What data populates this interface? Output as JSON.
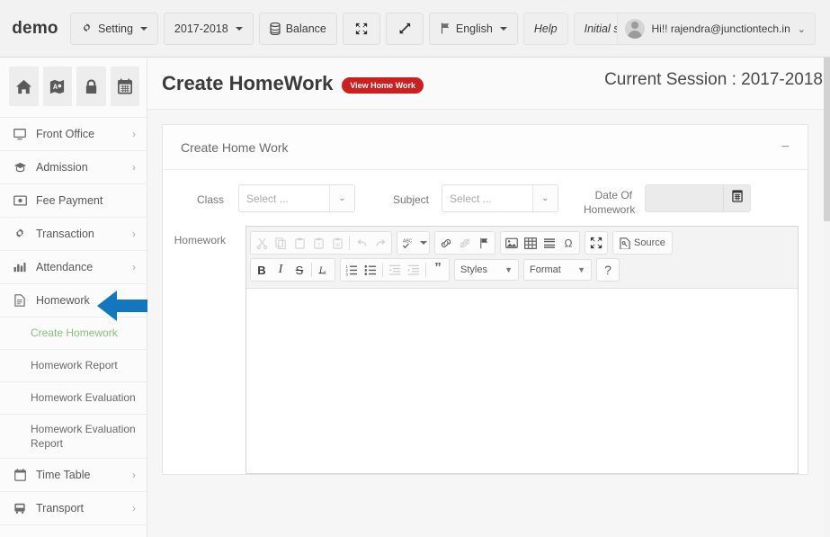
{
  "header": {
    "brand": "demo",
    "buttons": [
      {
        "label": "Setting",
        "icon": "gear-icon",
        "caret": true
      },
      {
        "label": "2017-2018",
        "icon": null,
        "caret": true
      },
      {
        "label": "Balance",
        "icon": "database-icon",
        "caret": false
      },
      {
        "label": "",
        "icon": "collapse-icon",
        "caret": false
      },
      {
        "label": "",
        "icon": "expand-icon",
        "caret": false
      },
      {
        "label": "English",
        "icon": "flag-icon",
        "caret": true
      },
      {
        "label": "Help",
        "icon": null,
        "caret": false
      },
      {
        "label": "Initial setup",
        "icon": null,
        "caret": false
      }
    ],
    "user": {
      "greeting": "Hi!! rajendra@junctiontech.in",
      "caret": "⌄"
    }
  },
  "sidebar": {
    "quick_icons": [
      "home-icon",
      "book-map-icon",
      "lock-icon",
      "calendar-icon"
    ],
    "items": [
      {
        "label": "Front Office",
        "icon": "monitor-icon",
        "chevron": "›"
      },
      {
        "label": "Admission",
        "icon": "graduation-cap-icon",
        "chevron": "›"
      },
      {
        "label": "Fee Payment",
        "icon": "money-icon",
        "chevron": ""
      },
      {
        "label": "Transaction",
        "icon": "gear-icon",
        "chevron": "›"
      },
      {
        "label": "Attendance",
        "icon": "bar-chart-icon",
        "chevron": "›"
      },
      {
        "label": "Homework",
        "icon": "file-icon",
        "chevron": ""
      }
    ],
    "subitems": [
      {
        "label": "Create Homework",
        "active": true
      },
      {
        "label": "Homework Report",
        "active": false
      },
      {
        "label": "Homework Evaluation",
        "active": false
      },
      {
        "label": "Homework Evaluation Report",
        "active": false
      }
    ],
    "items_after": [
      {
        "label": "Time Table",
        "icon": "calendar-icon",
        "chevron": "›"
      },
      {
        "label": "Transport",
        "icon": "bus-icon",
        "chevron": "›"
      }
    ],
    "active_color": "#87c279"
  },
  "page": {
    "title": "Create HomeWork",
    "badge": "View Home Work",
    "badge_color": "#cc1f1f",
    "session": "Current Session : 2017-2018"
  },
  "panel": {
    "title": "Create Home Work",
    "collapse_icon": "−"
  },
  "form": {
    "class": {
      "label": "Class",
      "value": "Select ...",
      "caret": "⌄"
    },
    "subject": {
      "label": "Subject",
      "value": "Select ...",
      "caret": "⌄"
    },
    "date": {
      "label": "Date Of Homework",
      "value": "",
      "button_icon": "calendar-icon"
    },
    "homework": {
      "label": "Homework",
      "content": ""
    }
  },
  "editor": {
    "row1": [
      {
        "name": "cut-icon",
        "glyph": "✂",
        "dim": true
      },
      {
        "name": "copy-icon",
        "glyph": "⎘",
        "dim": true
      },
      {
        "name": "paste-icon",
        "glyph": "ὌB",
        "dim": true
      },
      {
        "name": "paste-text-icon",
        "glyph": "T",
        "dim": true
      },
      {
        "name": "paste-word-icon",
        "glyph": "W",
        "dim": true
      },
      {
        "name": "undo-icon",
        "glyph": "↶",
        "dim": true
      },
      {
        "name": "redo-icon",
        "glyph": "↷",
        "dim": true
      },
      {
        "name": "spellcheck-icon",
        "glyph": "ABC",
        "dim": false
      },
      {
        "name": "link-icon",
        "glyph": "⚭",
        "dim": false
      },
      {
        "name": "unlink-icon",
        "glyph": "⚭",
        "dim": true
      },
      {
        "name": "anchor-icon",
        "glyph": "⚑",
        "dim": false
      },
      {
        "name": "image-icon",
        "glyph": "ὛC",
        "dim": false
      },
      {
        "name": "table-icon",
        "glyph": "⊞",
        "dim": false
      },
      {
        "name": "horizontal-rule-icon",
        "glyph": "≡",
        "dim": false
      },
      {
        "name": "special-char-icon",
        "glyph": "Ω",
        "dim": false
      },
      {
        "name": "maximize-icon",
        "glyph": "⤡",
        "dim": false
      },
      {
        "name": "source-button",
        "glyph": "Source",
        "dim": false
      }
    ],
    "row2": [
      {
        "name": "bold-icon",
        "glyph": "B",
        "dim": false
      },
      {
        "name": "italic-icon",
        "glyph": "I",
        "dim": false
      },
      {
        "name": "strikethrough-icon",
        "glyph": "S",
        "dim": false
      },
      {
        "name": "remove-format-icon",
        "glyph": "Ix",
        "dim": false
      },
      {
        "name": "numbered-list-icon",
        "glyph": "≣",
        "dim": false
      },
      {
        "name": "bulleted-list-icon",
        "glyph": "☰",
        "dim": false
      },
      {
        "name": "outdent-icon",
        "glyph": "⇤",
        "dim": true
      },
      {
        "name": "indent-icon",
        "glyph": "⇥",
        "dim": true
      },
      {
        "name": "blockquote-icon",
        "glyph": "”",
        "dim": false
      }
    ],
    "styles_label": "Styles",
    "format_label": "Format",
    "help_label": "?"
  },
  "annotation": {
    "arrow_color": "#1277bf",
    "direction": "left"
  }
}
